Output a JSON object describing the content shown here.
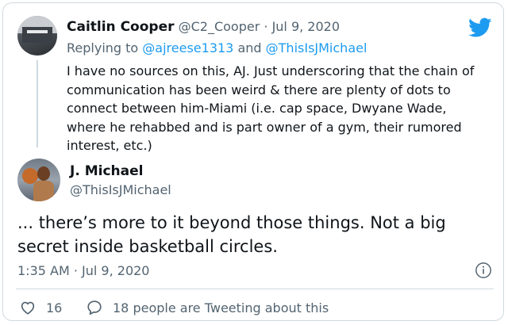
{
  "quoted_tweet": {
    "author_name": "Caitlin Cooper",
    "author_handle": "@C2_Cooper",
    "separator": "·",
    "date": "Jul 9, 2020",
    "replying_prefix": "Replying to",
    "replying_user_1": "@ajreese1313",
    "replying_and": "and",
    "replying_user_2": "@ThisIsJMichael",
    "text": "I have no sources on this, AJ. Just underscoring that the chain of communication has been weird & there are plenty of dots to connect between him-Miami (i.e. cap space, Dwyane Wade, where he rehabbed and is part owner of a gym, their rumored interest, etc.)"
  },
  "main_tweet": {
    "author_name": "J. Michael",
    "author_handle": "@ThisIsJMichael",
    "text": "... there’s more to it beyond those things. Not a big secret inside basketball circles.",
    "timestamp": "1:35 AM · Jul 9, 2020"
  },
  "actions": {
    "like_count": "16",
    "tweeting_text": "18 people are Tweeting about this"
  },
  "icons": {
    "logo": "twitter-bird-icon",
    "info": "info-icon",
    "like": "heart-icon",
    "reply": "speech-bubble-icon"
  },
  "colors": {
    "brand": "#1d9bf0",
    "muted": "#536471",
    "text": "#0f1419",
    "border": "#cfd9de"
  }
}
